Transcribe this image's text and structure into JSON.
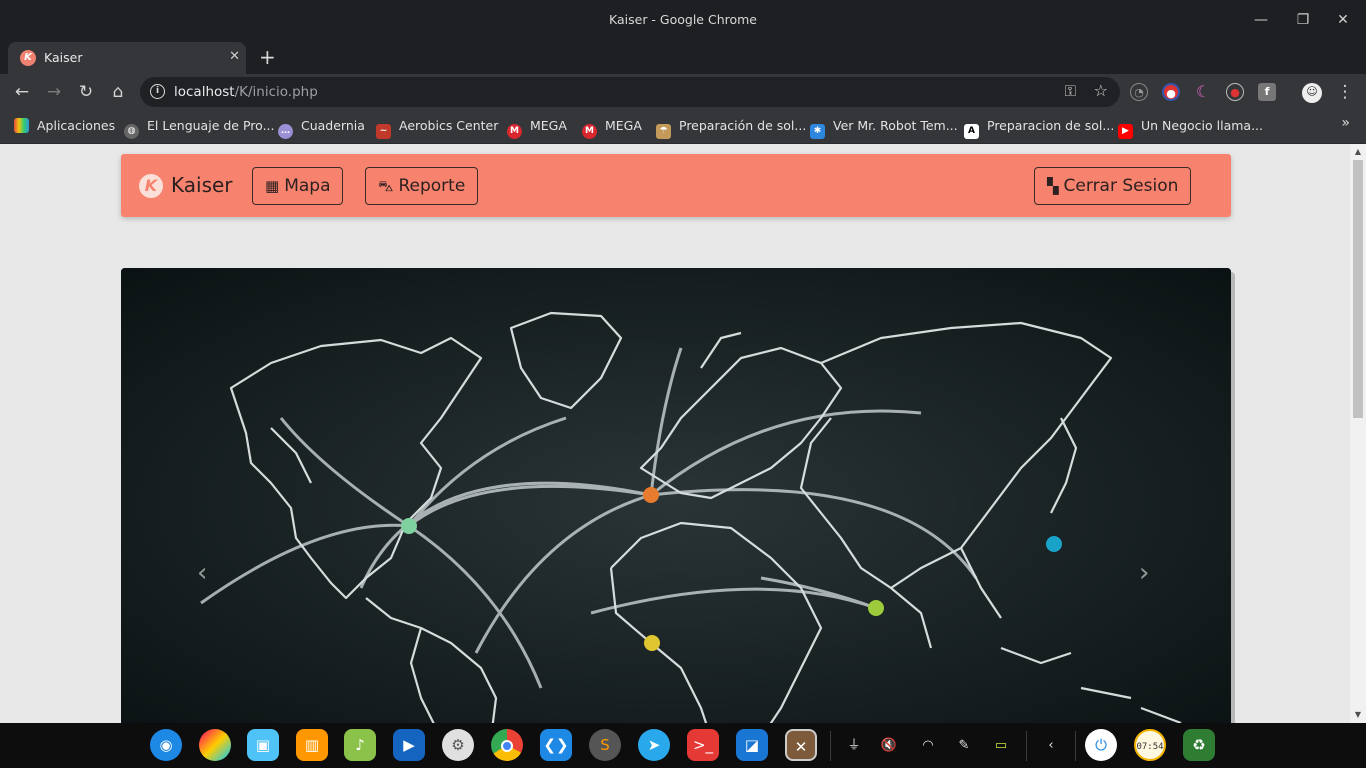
{
  "window": {
    "title": "Kaiser - Google Chrome"
  },
  "tab": {
    "title": "Kaiser"
  },
  "omnibox": {
    "host": "localhost",
    "path": "/K/inicio.php"
  },
  "bookmarks": [
    {
      "label": "Aplicaciones",
      "icon": "apps-grid-icon",
      "color": "#e74c3c"
    },
    {
      "label": "El Lenguaje de Pro...",
      "icon": "globe-icon",
      "color": "#666666"
    },
    {
      "label": "Cuadernia",
      "icon": "chat-bubble-icon",
      "color": "#9b8fd6"
    },
    {
      "label": "Aerobics Center",
      "icon": "aerobics-icon",
      "color": "#c0392b"
    },
    {
      "label": "MEGA",
      "icon": "mega-icon",
      "color": "#d9272e"
    },
    {
      "label": "MEGA",
      "icon": "mega-icon",
      "color": "#d9272e"
    },
    {
      "label": "Preparación de sol...",
      "icon": "umbrella-icon",
      "color": "#c49a5a"
    },
    {
      "label": "Ver Mr. Robot Tem...",
      "icon": "bug-icon",
      "color": "#2e86de"
    },
    {
      "label": "Preparacion de sol...",
      "icon": "letter-a-icon",
      "color": "#ffffff"
    },
    {
      "label": "Un Negocio llama...",
      "icon": "youtube-icon",
      "color": "#ff0000"
    }
  ],
  "navbar": {
    "brand": "Kaiser",
    "map_label": "Mapa",
    "report_label": "Reporte",
    "logout_label": "Cerrar Sesion",
    "color": "#f7836f"
  },
  "carousel": {
    "image": "world-map-chalkboard",
    "points": [
      {
        "color": "#7fd1a0"
      },
      {
        "color": "#e87b2d"
      },
      {
        "color": "#1aa3c9"
      },
      {
        "color": "#9ccc3c"
      },
      {
        "color": "#e0c731"
      }
    ]
  },
  "taskbar": {
    "apps": [
      "launcher-icon",
      "color-picker-icon",
      "store-icon",
      "archive-icon",
      "music-icon",
      "video-icon",
      "settings-icon",
      "chrome-icon",
      "vscode-icon",
      "sublime-icon",
      "telegram-icon",
      "terminal-icon",
      "window-icon",
      "tool-icon"
    ],
    "tray": [
      "usb-icon",
      "mute-icon",
      "wifi-icon",
      "pen-icon",
      "battery-icon",
      "chevron-left-icon",
      "power-icon",
      "clock-icon",
      "trash-icon"
    ],
    "clock": "07:54"
  }
}
